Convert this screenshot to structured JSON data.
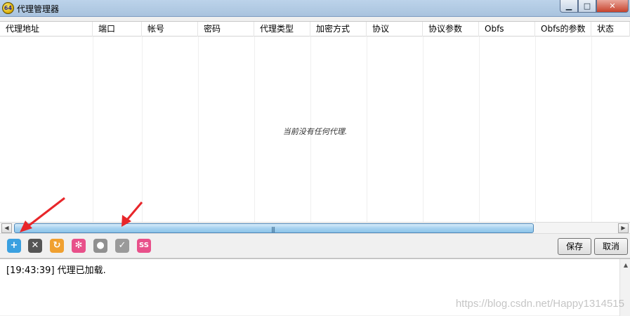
{
  "window": {
    "title": "代理管理器",
    "icon": "app-64-icon",
    "icon_text": "64",
    "minimize_glyph": "▁",
    "maximize_glyph": "□",
    "close_glyph": "✕"
  },
  "table": {
    "columns": [
      "代理地址",
      "端口",
      "帐号",
      "密码",
      "代理类型",
      "加密方式",
      "协议",
      "协议参数",
      "Obfs",
      "Obfs的参数",
      "状态"
    ],
    "empty_message": "当前没有任何代理."
  },
  "scrollbar": {
    "left_arrow": "◀",
    "right_arrow": "▶",
    "grip": "|||"
  },
  "toolbar": {
    "icons": [
      {
        "name": "add-icon",
        "glyph": "+",
        "color": "#3aa0e0"
      },
      {
        "name": "delete-icon",
        "glyph": "✕",
        "color": "#555555"
      },
      {
        "name": "refresh-icon",
        "glyph": "↻",
        "color": "#f0a030"
      },
      {
        "name": "settings-icon",
        "glyph": "✻",
        "color": "#e8508a"
      },
      {
        "name": "bulb-icon",
        "glyph": "●",
        "color": "#909090"
      },
      {
        "name": "check-icon",
        "glyph": "✓",
        "color": "#9a9a9a"
      },
      {
        "name": "ss-icon",
        "glyph": "SS",
        "color": "#e8508a"
      }
    ],
    "save_label": "保存",
    "cancel_label": "取消"
  },
  "log": {
    "line": "[19:43:39]  代理已加载.",
    "scroll_up": "▲"
  },
  "watermark": "https://blog.csdn.net/Happy1314515",
  "colors": {
    "arrow": "#e8262a",
    "scroll_thumb": "#a7d2f0"
  }
}
